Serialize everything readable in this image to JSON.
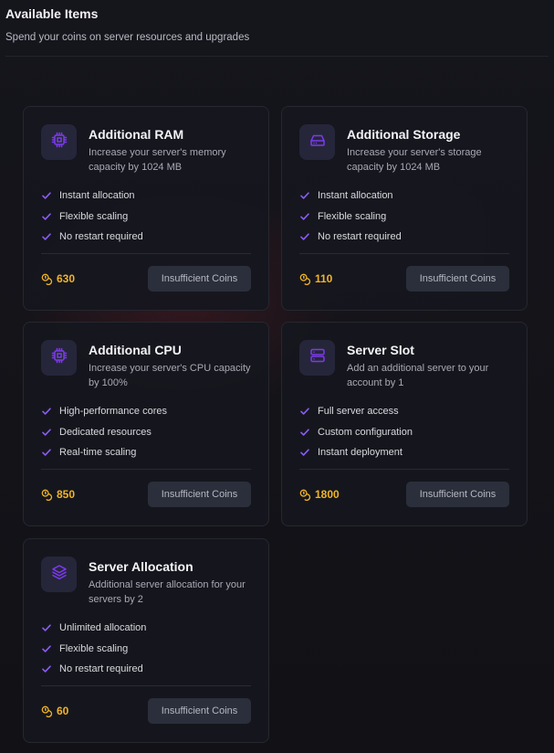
{
  "header": {
    "title": "Available Items",
    "subtitle": "Spend your coins on server resources and upgrades"
  },
  "colors": {
    "accent": "#7c3aed",
    "coin": "#f0b429",
    "button_bg": "#2b2f3b"
  },
  "items": [
    {
      "name": "Additional RAM",
      "icon": "ram-chip-icon",
      "description": "Increase your server's memory capacity by 1024 MB",
      "features": [
        "Instant allocation",
        "Flexible scaling",
        "No restart required"
      ],
      "price": "630",
      "button_label": "Insufficient Coins"
    },
    {
      "name": "Additional Storage",
      "icon": "storage-drive-icon",
      "description": "Increase your server's storage capacity by 1024 MB",
      "features": [
        "Instant allocation",
        "Flexible scaling",
        "No restart required"
      ],
      "price": "110",
      "button_label": "Insufficient Coins"
    },
    {
      "name": "Additional CPU",
      "icon": "cpu-chip-icon",
      "description": "Increase your server's CPU capacity by 100%",
      "features": [
        "High-performance cores",
        "Dedicated resources",
        "Real-time scaling"
      ],
      "price": "850",
      "button_label": "Insufficient Coins"
    },
    {
      "name": "Server Slot",
      "icon": "server-icon",
      "description": "Add an additional server to your account by 1",
      "features": [
        "Full server access",
        "Custom configuration",
        "Instant deployment"
      ],
      "price": "1800",
      "button_label": "Insufficient Coins"
    },
    {
      "name": "Server Allocation",
      "icon": "layers-icon",
      "description": "Additional server allocation for your servers by 2",
      "features": [
        "Unlimited allocation",
        "Flexible scaling",
        "No restart required"
      ],
      "price": "60",
      "button_label": "Insufficient Coins"
    }
  ]
}
